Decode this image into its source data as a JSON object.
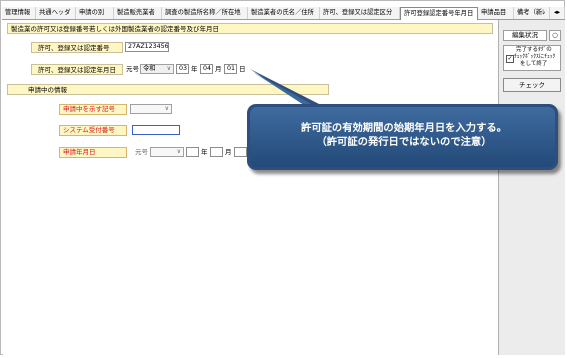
{
  "tabs": [
    {
      "label": "管理情報"
    },
    {
      "label": "共通ヘッダ"
    },
    {
      "label": "申請の別"
    },
    {
      "label": "製造販売業者"
    },
    {
      "label": "調査の製造所名称／所在地"
    },
    {
      "label": "製造業者の氏名／住所"
    },
    {
      "label": "許可、登録又は認定区分"
    },
    {
      "label": "許可登録認定番号年月日"
    },
    {
      "label": "申請品目"
    },
    {
      "label": "備考（新ﾚ"
    }
  ],
  "section1": {
    "title": "製造業の許可又は登録番号若しくは外国製造業者の認定番号及び年月日",
    "number_label": "許可、登録又は認定番号",
    "number_value": "27AZ123456",
    "date_label": "許可、登録又は認定年月日",
    "gengo_label": "元号",
    "era_value": "令和",
    "year_value": "03",
    "year_unit": "年",
    "month_value": "04",
    "month_unit": "月",
    "day_value": "01",
    "day_unit": "日"
  },
  "section2": {
    "title": "申請中の情報",
    "code_label": "申請中を示す記号",
    "receipt_label": "システム受付番号",
    "date_label": "申請年月日",
    "gengo_label": "元号",
    "year_unit": "年",
    "month_unit": "月"
  },
  "right_panel": {
    "status_label": "編集状況",
    "status_value": "○",
    "complete_line1": "完了するﾀｸﾞの",
    "complete_line2": "ﾁｪｯｸﾎﾞｯｸｽにﾁｪｯｸ",
    "complete_line3": "をして終了",
    "check_button": "チェック"
  },
  "callout": {
    "line1": "許可証の有効期間の始期年月日を入力する。",
    "line2": "（許可証の発行日ではないので注意）"
  },
  "colors": {
    "callout": "#2f5688",
    "required_text": "#d4181b",
    "label_bg": "#fef7c3"
  }
}
